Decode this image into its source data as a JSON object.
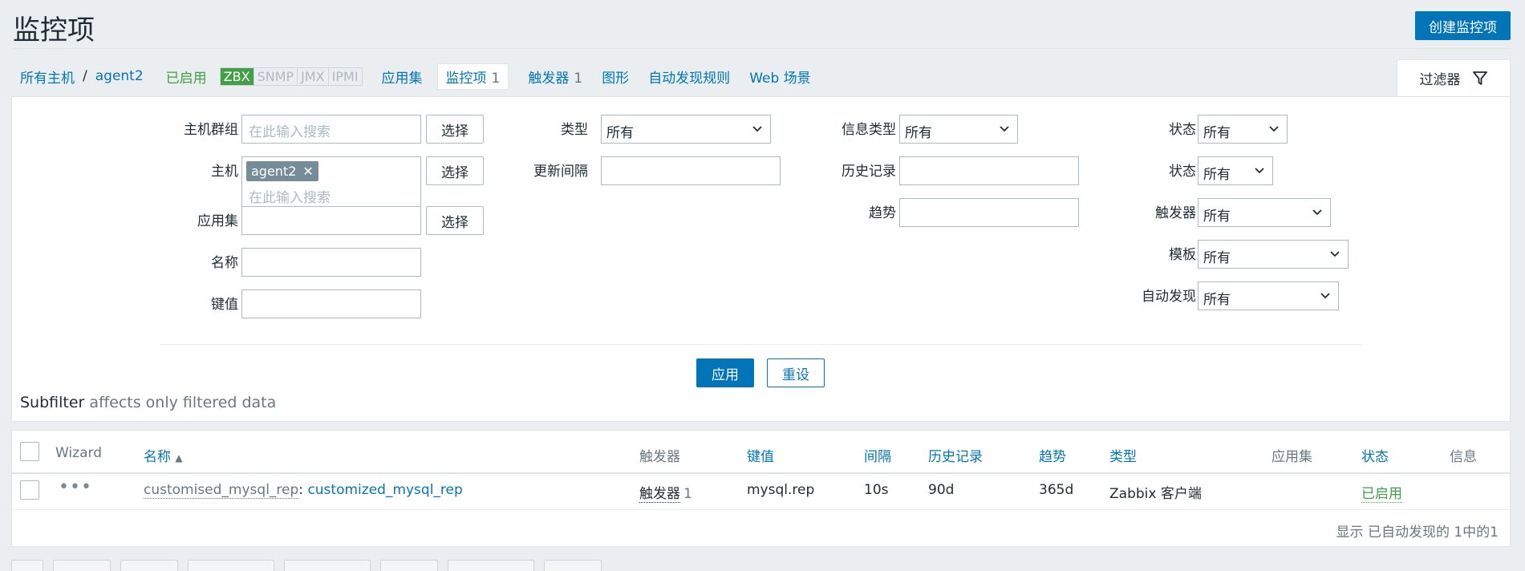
{
  "header": {
    "title": "监控项",
    "create_button": "创建监控项"
  },
  "hostnav": {
    "all_hosts": "所有主机",
    "separator": "/",
    "host": "agent2",
    "status": "已启用",
    "interfaces": [
      "ZBX",
      "SNMP",
      "JMX",
      "IPMI"
    ],
    "applications": "应用集",
    "items": "监控项",
    "items_count": "1",
    "triggers": "触发器",
    "triggers_count": "1",
    "graphs": "图形",
    "discovery": "自动发现规则",
    "web": "Web 场景"
  },
  "filter": {
    "tab_label": "过滤器",
    "host_groups_label": "主机群组",
    "host_groups_placeholder": "在此输入搜索",
    "select_label": "选择",
    "hosts_label": "主机",
    "host_tag": "agent2",
    "hosts_placeholder": "在此输入搜索",
    "application_label": "应用集",
    "name_label": "名称",
    "key_label": "键值",
    "type_label": "类型",
    "type_value": "所有",
    "interval_label": "更新间隔",
    "info_type_label": "信息类型",
    "info_type_value": "所有",
    "history_label": "历史记录",
    "trends_label": "趋势",
    "state_label": "状态",
    "state_value": "所有",
    "status_label": "状态",
    "status_value": "所有",
    "triggers_label": "触发器",
    "triggers_value": "所有",
    "template_label": "模板",
    "template_value": "所有",
    "discovery_label": "自动发现",
    "discovery_value": "所有",
    "apply": "应用",
    "reset": "重设",
    "subfilter_title": "Subfilter",
    "subfilter_note": "affects only filtered data"
  },
  "table": {
    "columns": {
      "wizard": "Wizard",
      "name": "名称",
      "sort_arrow": "▲",
      "triggers": "触发器",
      "key": "键值",
      "interval": "间隔",
      "history": "历史记录",
      "trends": "趋势",
      "type": "类型",
      "applications": "应用集",
      "status": "状态",
      "info": "信息"
    },
    "rows": [
      {
        "wizard": "•••",
        "template": "customised_mysql_rep",
        "name_sep": ":",
        "name": "customized_mysql_rep",
        "triggers": "触发器",
        "triggers_count": "1",
        "key": "mysql.rep",
        "interval": "10s",
        "history": "90d",
        "trends": "365d",
        "type": "Zabbix 客户端",
        "status": "已启用"
      }
    ],
    "footer": "显示 已自动发现的 1中的1"
  }
}
